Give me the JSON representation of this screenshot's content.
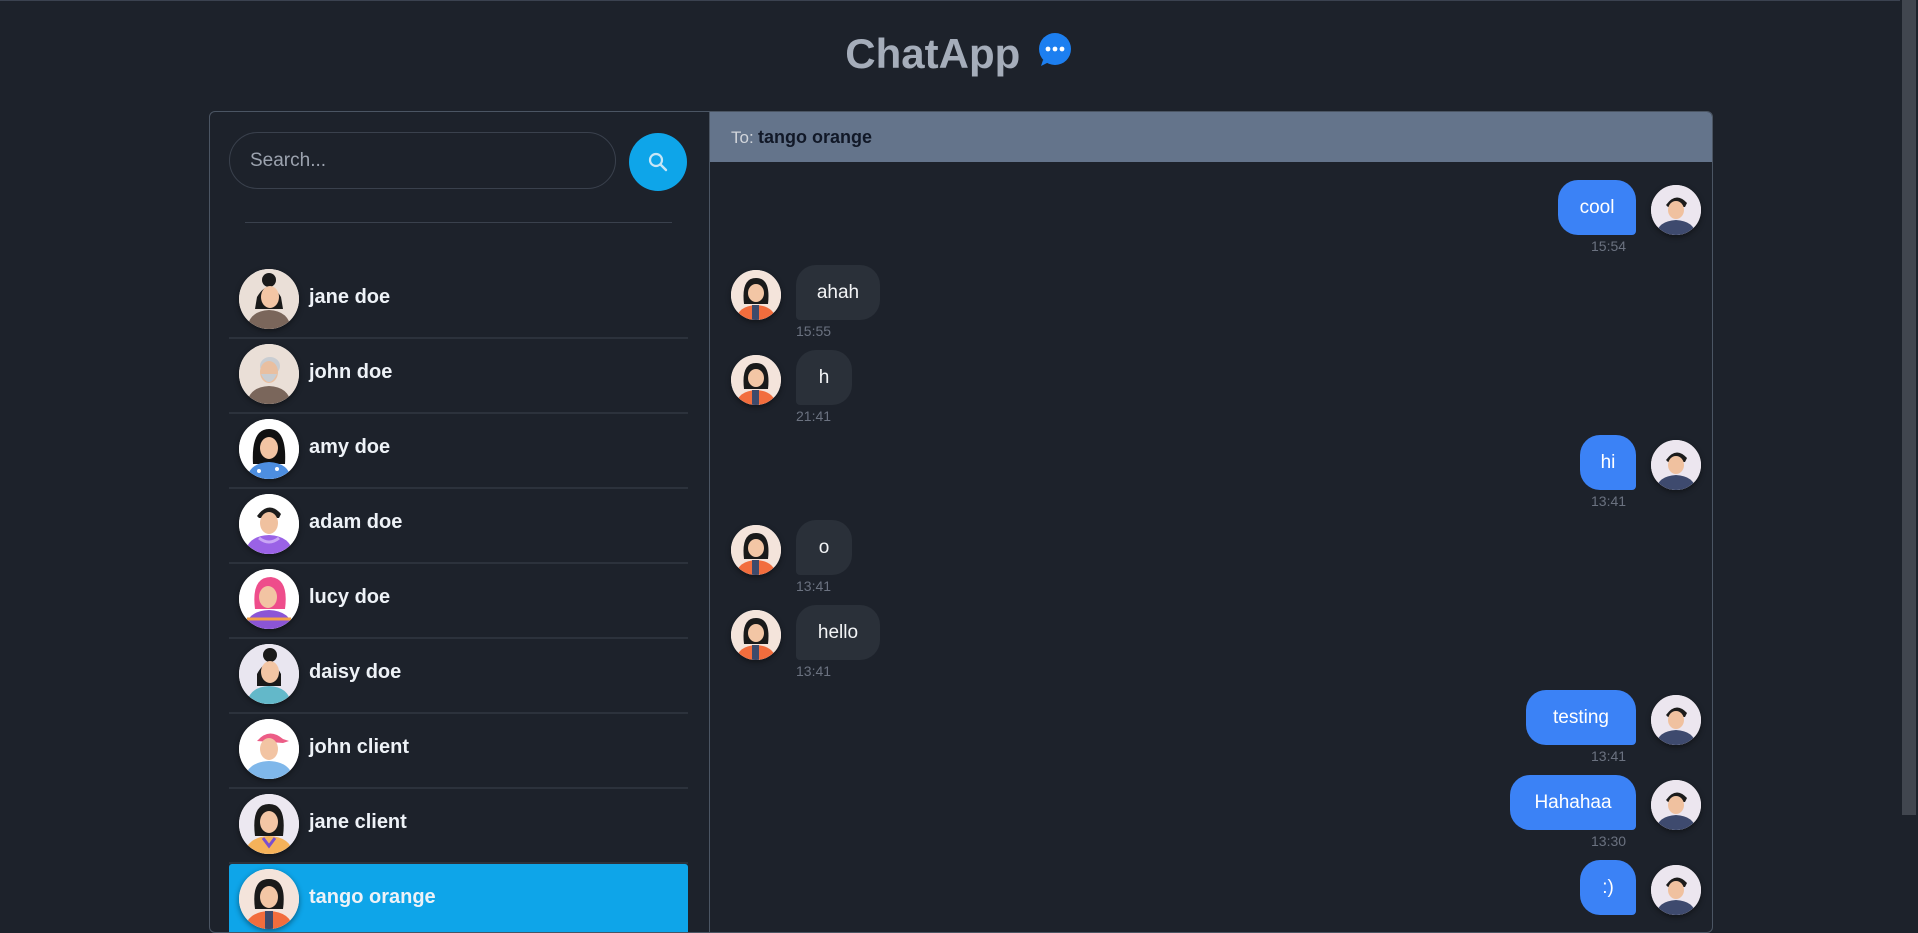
{
  "app": {
    "title": "ChatApp",
    "brand_icon": "chat-bubble-icon",
    "accent": "#0ea5e9",
    "out_bubble": "#3b82f6"
  },
  "search": {
    "placeholder": "Search...",
    "button_icon": "search-icon"
  },
  "contacts": [
    {
      "name": "jane doe",
      "avatar": "woman-bun-brown-shirt",
      "active": false
    },
    {
      "name": "john doe",
      "avatar": "old-man-beard",
      "active": false
    },
    {
      "name": "amy doe",
      "avatar": "woman-long-hair-blue",
      "active": false
    },
    {
      "name": "adam doe",
      "avatar": "man-purple-hoodie",
      "active": false
    },
    {
      "name": "lucy doe",
      "avatar": "woman-pink-hair",
      "active": false
    },
    {
      "name": "daisy doe",
      "avatar": "woman-teal-shirt",
      "active": false
    },
    {
      "name": "john client",
      "avatar": "man-pink-cap",
      "active": false
    },
    {
      "name": "jane client",
      "avatar": "woman-orange-shirt",
      "active": false
    },
    {
      "name": "tango orange",
      "avatar": "woman-orange-top",
      "active": true
    }
  ],
  "chat": {
    "to_label": "To:",
    "to_name": "tango orange",
    "messages": [
      {
        "direction": "out",
        "text": "cool",
        "time": "15:54"
      },
      {
        "direction": "in",
        "text": "ahah",
        "time": "15:55"
      },
      {
        "direction": "in",
        "text": "h",
        "time": "21:41"
      },
      {
        "direction": "out",
        "text": "hi",
        "time": "13:41"
      },
      {
        "direction": "in",
        "text": "o",
        "time": "13:41"
      },
      {
        "direction": "in",
        "text": "hello",
        "time": "13:41"
      },
      {
        "direction": "out",
        "text": "testing",
        "time": "13:41"
      },
      {
        "direction": "out",
        "text": "Hahahaa",
        "time": "13:30"
      },
      {
        "direction": "out",
        "text": ":)",
        "time": ""
      }
    ]
  }
}
